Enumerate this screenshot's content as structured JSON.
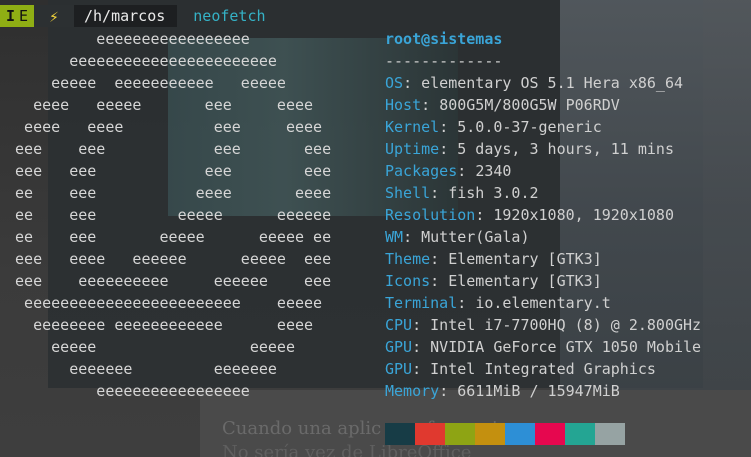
{
  "prompt": {
    "mode_letters": [
      "I",
      "E"
    ],
    "bolt_glyph": "⚡",
    "path": "/h/marcos",
    "command": "neofetch"
  },
  "logo_lines": [
    "          eeeeeeeeeeeeeeeee",
    "       eeeeeeeeeeeeeeeeeeeeeee",
    "     eeeee  eeeeeeeeeee   eeeee",
    "   eeee   eeeee       eee     eeee",
    "  eeee   eeee          eee     eeee",
    " eee    eee            eee       eee",
    " eee   eee            eee        eee",
    " ee    eee           eeee       eeee",
    " ee    eee         eeeee      eeeeee",
    " ee    eee       eeeee      eeeee ee",
    " eee   eeee   eeeeee      eeeee  eee",
    " eee    eeeeeeeeee     eeeeee    eee",
    "  eeeeeeeeeeeeeeeeeeeeeeee    eeeee",
    "   eeeeeeee eeeeeeeeeeee      eeee",
    "     eeeee                 eeeee",
    "       eeeeeee         eeeeeee",
    "          eeeeeeeeeeeeeeeee"
  ],
  "header": {
    "user": "root",
    "at": "@",
    "host": "sistemas",
    "separator": "-------------"
  },
  "info": [
    {
      "key": "OS",
      "value": "elementary OS 5.1 Hera x86_64"
    },
    {
      "key": "Host",
      "value": "800G5M/800G5W P06RDV"
    },
    {
      "key": "Kernel",
      "value": "5.0.0-37-generic"
    },
    {
      "key": "Uptime",
      "value": "5 days, 3 hours, 11 mins"
    },
    {
      "key": "Packages",
      "value": "2340"
    },
    {
      "key": "Shell",
      "value": "fish 3.0.2"
    },
    {
      "key": "Resolution",
      "value": "1920x1080, 1920x1080"
    },
    {
      "key": "WM",
      "value": "Mutter(Gala)"
    },
    {
      "key": "Theme",
      "value": "Elementary [GTK3]"
    },
    {
      "key": "Icons",
      "value": "Elementary [GTK3]"
    },
    {
      "key": "Terminal",
      "value": "io.elementary.t"
    },
    {
      "key": "CPU",
      "value": "Intel i7-7700HQ (8) @ 2.800GHz"
    },
    {
      "key": "GPU",
      "value": "NVIDIA GeForce GTX 1050 Mobile"
    },
    {
      "key": "GPU",
      "value": "Intel Integrated Graphics"
    },
    {
      "key": "Memory",
      "value": "6611MiB / 15947MiB"
    }
  ],
  "separator_char": ": ",
  "palette": [
    "#173c46",
    "#e0392f",
    "#8ea414",
    "#c4900f",
    "#2d8fd6",
    "#e6074f",
    "#24a593",
    "#96a3a3"
  ],
  "background_text": {
    "line1": "Cuando una aplic                    una forma, i",
    "line2": "No sería             vez de LibreOffice"
  }
}
